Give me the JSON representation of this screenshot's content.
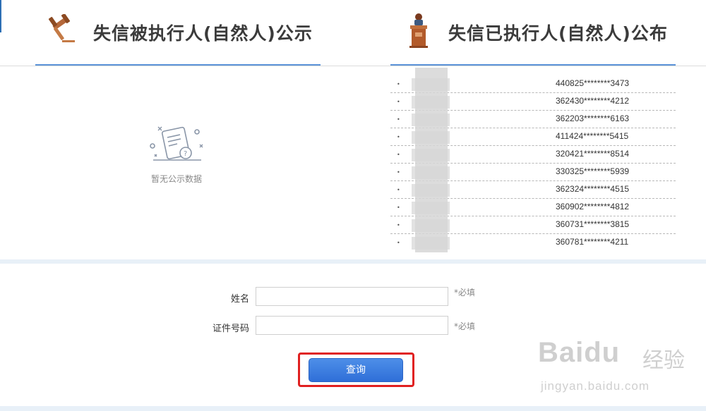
{
  "left_panel": {
    "title": "失信被执行人(自然人)公示",
    "empty_text": "暂无公示数据"
  },
  "right_panel": {
    "title": "失信已执行人(自然人)公布",
    "bullet": "•",
    "rows": [
      {
        "id": "440825********3473"
      },
      {
        "id": "362430********4212"
      },
      {
        "id": "362203********6163"
      },
      {
        "id": "411424********5415"
      },
      {
        "id": "320421********8514"
      },
      {
        "id": "330325********5939"
      },
      {
        "id": "362324********4515"
      },
      {
        "id": "360902********4812"
      },
      {
        "id": "360731********3815"
      },
      {
        "id": "360781********4211"
      }
    ]
  },
  "form": {
    "name_label": "姓名",
    "name_value": "",
    "id_label": "证件号码",
    "id_value": "",
    "required_text": "*必填",
    "query_label": "查询"
  },
  "watermark": {
    "logo": "Baidu",
    "cn": "经验",
    "url": "jingyan.baidu.com"
  },
  "colors": {
    "accent_blue": "#5b93d8",
    "button_blue": "#3a7be0",
    "highlight_red": "#e02020"
  },
  "icons": {
    "left_header": "gavel-icon",
    "right_header": "podium-speaker-icon",
    "empty_state": "document-question-icon"
  }
}
